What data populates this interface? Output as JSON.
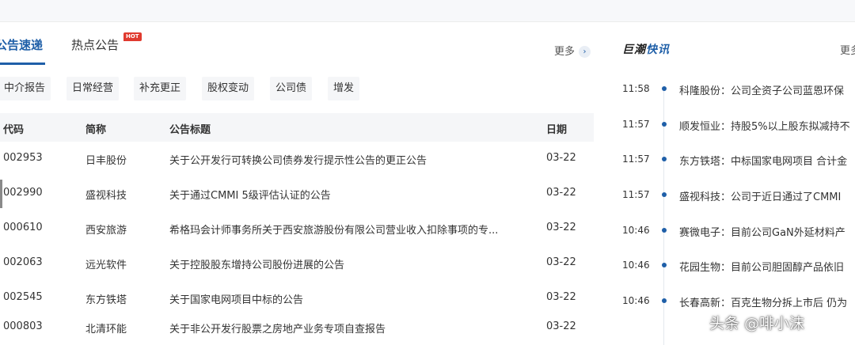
{
  "tabs": {
    "active": "公告速递",
    "hot": "热点公告",
    "hot_badge": "HOT",
    "more": "更多",
    "more_arrow": "›"
  },
  "filters": [
    "中介报告",
    "日常经营",
    "补充更正",
    "股权变动",
    "公司债",
    "增发"
  ],
  "table": {
    "headers": {
      "code": "代码",
      "name": "简称",
      "title": "公告标题",
      "date": "日期"
    },
    "rows": [
      {
        "code": "002953",
        "name": "日丰股份",
        "title": "关于公开发行可转换公司债券发行提示性公告的更正公告",
        "date": "03-22"
      },
      {
        "code": "002990",
        "name": "盛视科技",
        "title": "关于通过CMMI 5级评估认证的公告",
        "date": "03-22"
      },
      {
        "code": "000610",
        "name": "西安旅游",
        "title": "希格玛会计师事务所关于西安旅游股份有限公司营业收入扣除事项的专...",
        "date": "03-22"
      },
      {
        "code": "002063",
        "name": "远光软件",
        "title": "关于控股股东增持公司股份进展的公告",
        "date": "03-22"
      },
      {
        "code": "002545",
        "name": "东方铁塔",
        "title": "关于国家电网项目中标的公告",
        "date": "03-22"
      },
      {
        "code": "000803",
        "name": "北清环能",
        "title": "关于非公开发行股票之房地产业务专项自查报告",
        "date": "03-22"
      }
    ]
  },
  "news_panel": {
    "title_a": "巨潮",
    "title_b": "快讯",
    "more": "更多",
    "items": [
      {
        "time": "11:58",
        "text": "科隆股份：公司全资子公司蓝恩环保"
      },
      {
        "time": "11:57",
        "text": "顺发恒业：持股5%以上股东拟减持不"
      },
      {
        "time": "11:57",
        "text": "东方铁塔：中标国家电网项目 合计金"
      },
      {
        "time": "11:57",
        "text": "盛视科技：公司于近日通过了CMMI"
      },
      {
        "time": "10:46",
        "text": "赛微电子：目前公司GaN外延材料产"
      },
      {
        "time": "10:46",
        "text": "花园生物：目前公司胆固醇产品依旧"
      },
      {
        "time": "10:46",
        "text": "长春高新：百克生物分拆上市后 仍为"
      }
    ]
  },
  "watermark": "头条 @啡小沫",
  "colors": {
    "accent": "#1f5fa8",
    "hot": "#e03a2f",
    "header_bg": "#f5f6f8"
  }
}
